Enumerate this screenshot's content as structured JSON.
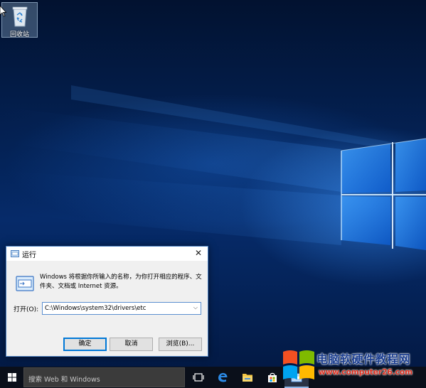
{
  "desktop": {
    "recycle_bin_label": "回收站"
  },
  "run_dialog": {
    "title": "运行",
    "description": "Windows 将根据你所输入的名称，为你打开相应的程序、文件夹、文档或 Internet 资源。",
    "open_label": "打开(O):",
    "open_value": "C:\\Windows\\system32\\drivers\\etc",
    "close_glyph": "✕",
    "buttons": {
      "ok": "确定",
      "cancel": "取消",
      "browse": "浏览(B)..."
    }
  },
  "taskbar": {
    "search_placeholder": "搜索 Web 和 Windows",
    "items": [
      "task-view",
      "edge",
      "file-explorer",
      "store",
      "run"
    ]
  },
  "watermark": {
    "title": "电脑软硬件教程网",
    "url": "www.computer26.com"
  },
  "colors": {
    "accent": "#0078d7",
    "taskbar": "#0a0f1a",
    "wallpaper": "#04245a"
  }
}
